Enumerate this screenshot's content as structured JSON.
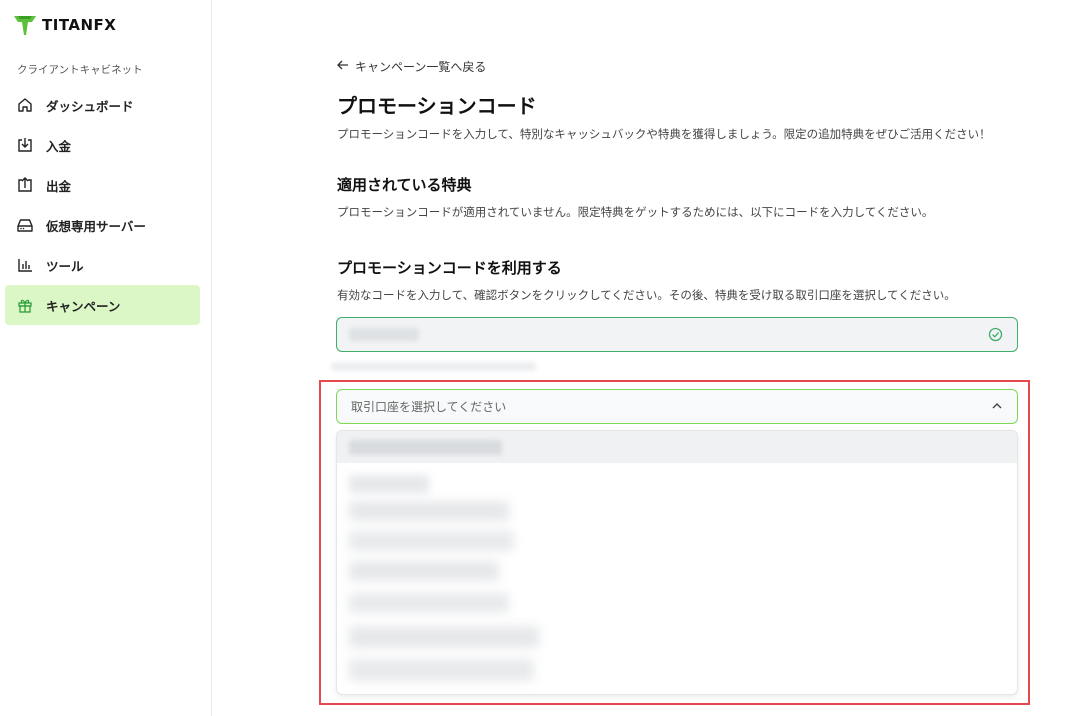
{
  "brand": {
    "name": "TITANFX",
    "accent": "#7ed957"
  },
  "sidebar": {
    "section_label": "クライアントキャビネット",
    "items": [
      {
        "label": "ダッシュボード",
        "icon": "home-icon"
      },
      {
        "label": "入金",
        "icon": "deposit-icon"
      },
      {
        "label": "出金",
        "icon": "withdraw-icon"
      },
      {
        "label": "仮想専用サーバー",
        "icon": "server-icon"
      },
      {
        "label": "ツール",
        "icon": "chart-icon"
      },
      {
        "label": "キャンペーン",
        "icon": "gift-icon",
        "active": true
      }
    ]
  },
  "main": {
    "back_link": "キャンペーン一覧へ戻る",
    "title": "プロモーションコード",
    "description": "プロモーションコードを入力して、特別なキャッシュバックや特典を獲得しましょう。限定の追加特典をぜひご活用ください！",
    "applied": {
      "heading": "適用されている特典",
      "text": "プロモーションコードが適用されていません。限定特典をゲットするためには、以下にコードを入力してください。"
    },
    "use_code": {
      "heading": "プロモーションコードを利用する",
      "text": "有効なコードを入力して、確認ボタンをクリックしてください。その後、特典を受け取る取引口座を選択してください。"
    },
    "account_select": {
      "placeholder": "取引口座を選択してください"
    }
  }
}
